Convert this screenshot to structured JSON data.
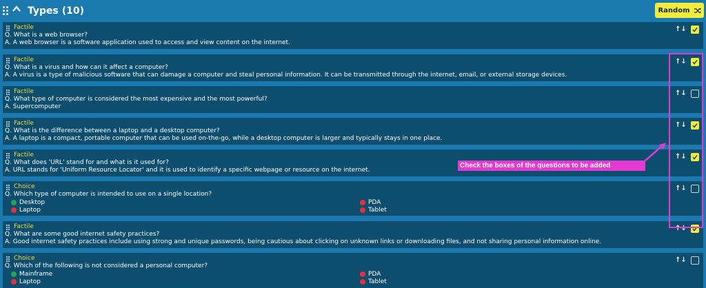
{
  "header": {
    "title": "Types (10)",
    "random_label": "Random"
  },
  "annotation": {
    "callout": "Check the boxes of the questions to be added"
  },
  "cards": [
    {
      "type": "Factile",
      "question": "Q. What is a web browser?",
      "answer": "A. A web browser is a software application used to access and view content on the internet.",
      "checked": true
    },
    {
      "type": "Factile",
      "question": "Q. What is a virus and how can it affect a computer?",
      "answer": "A. A virus is a type of malicious software that can damage a computer and steal personal information. It can be transmitted through the internet, email, or external storage devices.",
      "checked": true
    },
    {
      "type": "Factile",
      "question": "Q. What type of computer is considered the most expensive and the most powerful?",
      "answer": "A. Supercomputer",
      "checked": false
    },
    {
      "type": "Factile",
      "question": "Q. What is the difference between a laptop and a desktop computer?",
      "answer": "A. A laptop is a compact, portable computer that can be used on-the-go, while a desktop computer is larger and typically stays in one place.",
      "checked": true
    },
    {
      "type": "Factile",
      "question": "Q. What does 'URL' stand for and what is it used for?",
      "answer": "A. URL stands for 'Uniform Resource Locator' and it is used to identify a specific webpage or resource on the internet.",
      "checked": true
    },
    {
      "type": "Choice",
      "question": "Q. Which type of computer is intended to use on a single location?",
      "options": [
        "Desktop",
        "PDA",
        "Laptop",
        "Tablet"
      ],
      "correct": [
        true,
        false,
        false,
        false
      ],
      "checked": false
    },
    {
      "type": "Factile",
      "question": "Q. What are some good internet safety practices?",
      "answer": "A. Good internet safety practices include using strong and unique passwords, being cautious about clicking on unknown links or downloading files, and not sharing personal information online.",
      "checked": true
    },
    {
      "type": "Choice",
      "question": "Q. Which of the following is not considered a personal computer?",
      "options": [
        "Mainframe",
        "PDA",
        "Laptop",
        "Tablet"
      ],
      "correct": [
        true,
        false,
        false,
        false
      ],
      "checked": false
    }
  ],
  "icons": {
    "reorder": "↑↓",
    "collapse": "chevron-up-icon",
    "drag": "drag-handle-icon",
    "shuffle": "shuffle-icon"
  },
  "colors": {
    "background": "#1a7aaf",
    "card": "#0d4d6e",
    "type_label": "#f2dc3a",
    "accent": "#f4ec3b",
    "annotation": "#e53ad1",
    "correct": "#22a65a",
    "incorrect": "#e0313f"
  }
}
